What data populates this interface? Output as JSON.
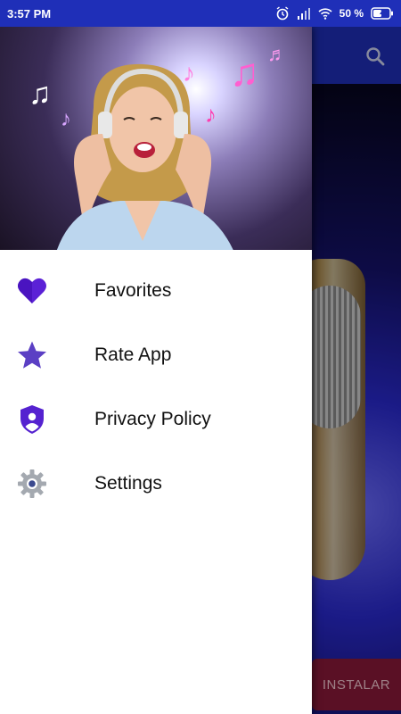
{
  "status_bar": {
    "time": "3:57 PM",
    "battery": "50 %",
    "icons": [
      "alarm-icon",
      "signal-icon",
      "wifi-icon",
      "battery-charging-icon"
    ]
  },
  "app": {
    "toolbar_color": "#1f2fb8",
    "search_icon": "search-icon",
    "install_label": "INSTALAR"
  },
  "drawer": {
    "header_image": "woman-with-headphones-music-notes",
    "items": [
      {
        "label": "Favorites",
        "icon": "heart-icon",
        "color": "#5b21d6"
      },
      {
        "label": "Rate App",
        "icon": "star-icon",
        "color": "#5b3fc4"
      },
      {
        "label": "Privacy Policy",
        "icon": "shield-user-icon",
        "color": "#5522d0"
      },
      {
        "label": "Settings",
        "icon": "gear-icon",
        "color": "#9aa0a6"
      }
    ]
  }
}
